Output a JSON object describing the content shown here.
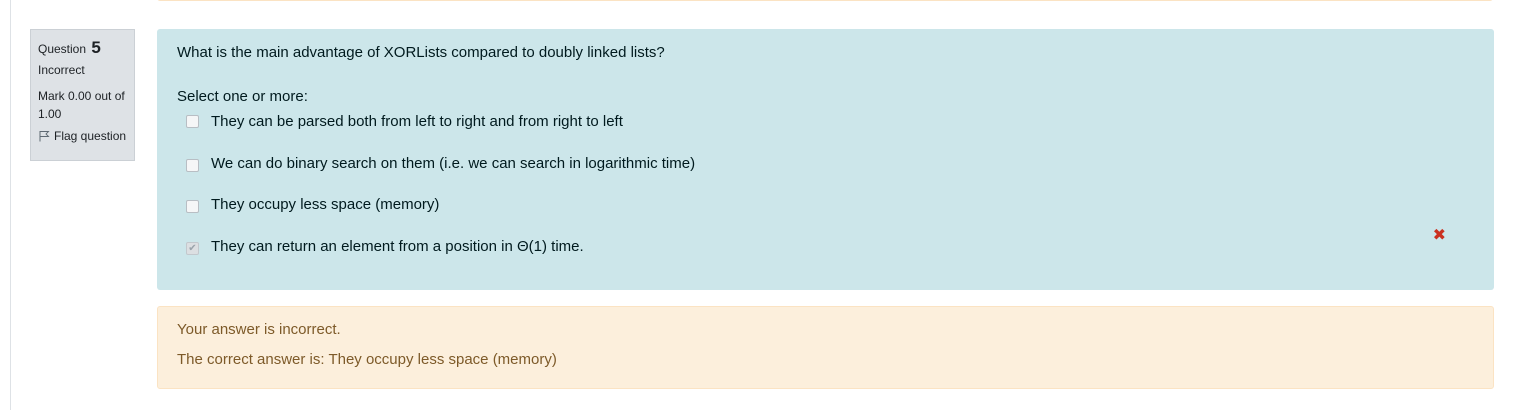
{
  "info": {
    "question_label": "Question",
    "question_number": "5",
    "state": "Incorrect",
    "grade": "Mark 0.00 out of 1.00",
    "flag_label": "Flag question"
  },
  "question": {
    "text": "What is the main advantage of XORLists compared to doubly linked lists?",
    "prompt": "Select one or more:",
    "answers": [
      {
        "label": "They can be parsed both from left to right and from right to left",
        "checked": false
      },
      {
        "label": "We can do binary search on them (i.e. we can search in logarithmic time)",
        "checked": false
      },
      {
        "label": "They occupy less space (memory)",
        "checked": false
      },
      {
        "label": "They can return an element from a position in Θ(1) time.",
        "checked": true,
        "mark": "incorrect"
      }
    ]
  },
  "feedback": {
    "result": "Your answer is incorrect.",
    "right_answer": "The correct answer is: They occupy less space (memory)"
  },
  "colors": {
    "content_bg": "#cce6ea",
    "feedback_bg": "#fcefdc",
    "info_bg": "#dee2e6",
    "incorrect_red": "#ca3120"
  }
}
